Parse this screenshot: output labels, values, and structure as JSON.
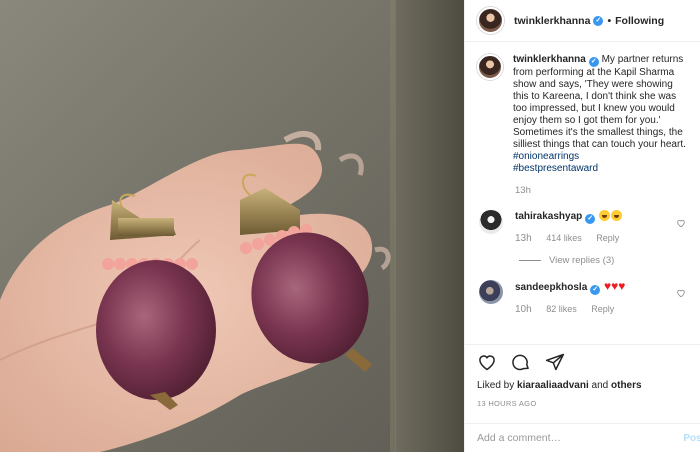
{
  "post": {
    "username": "twinklerkhanna",
    "verified_mark": "✓",
    "separator": "•",
    "follow_status": "Following",
    "caption_user": "twinklerkhanna",
    "caption_text": "My partner returns from performing at the Kapil Sharma show and says, 'They were showing this to Kareena, I don't think she was too impressed, but I knew you would enjoy them so I got them for you.' Sometimes it's the smallest things, the silliest things that can touch your heart.",
    "hashtags": [
      "#onionearrings",
      "#bestpresentaward"
    ],
    "caption_time": "13h"
  },
  "comments": [
    {
      "user": "tahirakashyap",
      "time": "13h",
      "likes": "414 likes",
      "reply": "Reply",
      "view_replies": "View replies (3)"
    },
    {
      "user": "sandeepkhosla",
      "hearts": "♥♥♥",
      "time": "10h",
      "likes": "82 likes",
      "reply": "Reply"
    }
  ],
  "footer": {
    "liked_by_prefix": "Liked by ",
    "liked_by_user": "kiaraaliaadvani",
    "liked_by_and": " and ",
    "liked_by_others": "others",
    "time_ago": "13 HOURS AGO",
    "add_comment_placeholder": "Add a comment…",
    "post_label": "Post"
  },
  "icons": {
    "like": "heart-icon",
    "comment": "comment-icon",
    "share": "share-icon",
    "comment_like": "heart-outline-icon"
  },
  "colors": {
    "link": "#003569",
    "meta": "#8e8e8e",
    "verified": "#3897f0",
    "red_heart": "#ed1c24",
    "post_disabled": "#b2dffc"
  }
}
